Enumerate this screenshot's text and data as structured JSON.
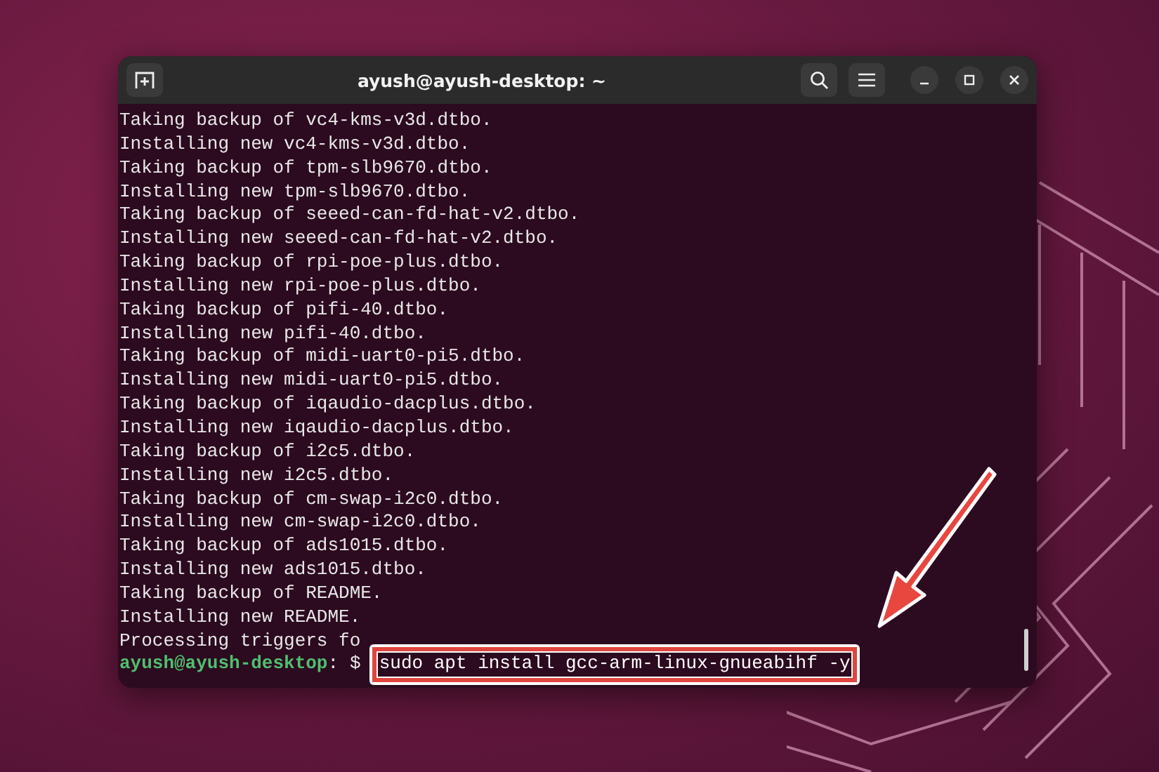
{
  "window": {
    "title": "ayush@ayush-desktop: ~"
  },
  "terminal": {
    "lines": [
      "Taking backup of vc4-kms-v3d.dtbo.",
      "Installing new vc4-kms-v3d.dtbo.",
      "Taking backup of tpm-slb9670.dtbo.",
      "Installing new tpm-slb9670.dtbo.",
      "Taking backup of seeed-can-fd-hat-v2.dtbo.",
      "Installing new seeed-can-fd-hat-v2.dtbo.",
      "Taking backup of rpi-poe-plus.dtbo.",
      "Installing new rpi-poe-plus.dtbo.",
      "Taking backup of pifi-40.dtbo.",
      "Installing new pifi-40.dtbo.",
      "Taking backup of midi-uart0-pi5.dtbo.",
      "Installing new midi-uart0-pi5.dtbo.",
      "Taking backup of iqaudio-dacplus.dtbo.",
      "Installing new iqaudio-dacplus.dtbo.",
      "Taking backup of i2c5.dtbo.",
      "Installing new i2c5.dtbo.",
      "Taking backup of cm-swap-i2c0.dtbo.",
      "Installing new cm-swap-i2c0.dtbo.",
      "Taking backup of ads1015.dtbo.",
      "Installing new ads1015.dtbo.",
      "Taking backup of README.",
      "Installing new README.",
      "Processing triggers fo"
    ],
    "prompt": {
      "user_host": "ayush@ayush-desktop",
      "separator": ":",
      "symbol": "$",
      "command": "sudo apt install gcc-arm-linux-gnueabihf -y"
    }
  }
}
